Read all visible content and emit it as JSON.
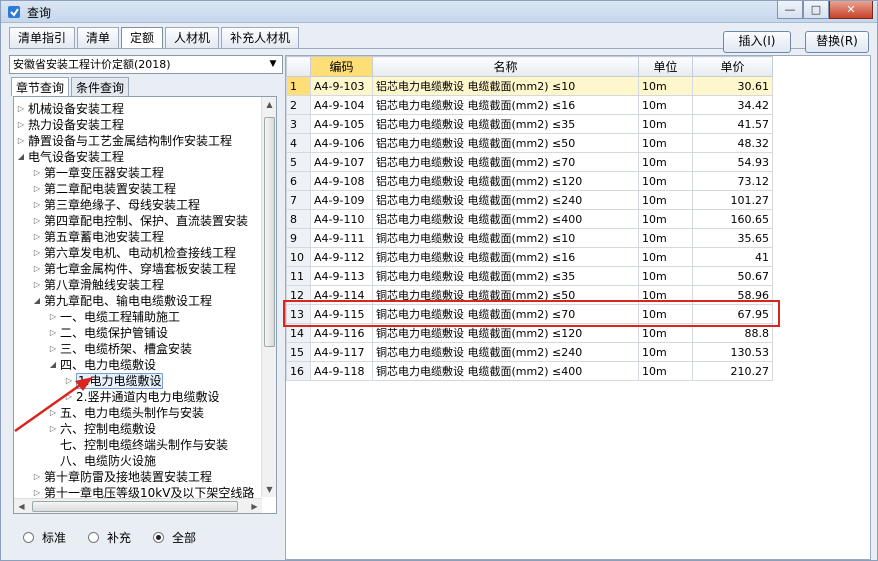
{
  "window": {
    "title": "查询"
  },
  "top_tabs": [
    {
      "label": "清单指引",
      "active": false
    },
    {
      "label": "清单",
      "active": false
    },
    {
      "label": "定额",
      "active": true
    },
    {
      "label": "人材机",
      "active": false
    },
    {
      "label": "补充人材机",
      "active": false
    }
  ],
  "buttons": {
    "insert": "插入(I)",
    "replace": "替换(R)"
  },
  "combo": {
    "value": "安徽省安装工程计价定额(2018)"
  },
  "left_tabs": [
    {
      "label": "章节查询",
      "active": true
    },
    {
      "label": "条件查询",
      "active": false
    }
  ],
  "tree": [
    {
      "label": "机械设备安装工程",
      "level": 0,
      "toggle": "▷"
    },
    {
      "label": "热力设备安装工程",
      "level": 0,
      "toggle": "▷"
    },
    {
      "label": "静置设备与工艺金属结构制作安装工程",
      "level": 0,
      "toggle": "▷"
    },
    {
      "label": "电气设备安装工程",
      "level": 0,
      "toggle": "◢"
    },
    {
      "label": "第一章变压器安装工程",
      "level": 1,
      "toggle": "▷"
    },
    {
      "label": "第二章配电装置安装工程",
      "level": 1,
      "toggle": "▷"
    },
    {
      "label": "第三章绝缘子、母线安装工程",
      "level": 1,
      "toggle": "▷"
    },
    {
      "label": "第四章配电控制、保护、直流装置安装",
      "level": 1,
      "toggle": "▷"
    },
    {
      "label": "第五章蓄电池安装工程",
      "level": 1,
      "toggle": "▷"
    },
    {
      "label": "第六章发电机、电动机检查接线工程",
      "level": 1,
      "toggle": "▷"
    },
    {
      "label": "第七章金属构件、穿墙套板安装工程",
      "level": 1,
      "toggle": "▷"
    },
    {
      "label": "第八章滑触线安装工程",
      "level": 1,
      "toggle": "▷"
    },
    {
      "label": "第九章配电、输电电缆敷设工程",
      "level": 1,
      "toggle": "◢"
    },
    {
      "label": "一、电缆工程辅助施工",
      "level": 2,
      "toggle": "▷"
    },
    {
      "label": "二、电缆保护管铺设",
      "level": 2,
      "toggle": "▷"
    },
    {
      "label": "三、电缆桥架、槽盒安装",
      "level": 2,
      "toggle": "▷"
    },
    {
      "label": "四、电力电缆敷设",
      "level": 2,
      "toggle": "◢"
    },
    {
      "label": "1.电力电缆敷设",
      "level": 3,
      "toggle": "▷",
      "selected": true
    },
    {
      "label": "2.竖井通道内电力电缆敷设",
      "level": 3,
      "toggle": "▷"
    },
    {
      "label": "五、电力电缆头制作与安装",
      "level": 2,
      "toggle": "▷"
    },
    {
      "label": "六、控制电缆敷设",
      "level": 2,
      "toggle": "▷"
    },
    {
      "label": "七、控制电缆终端头制作与安装",
      "level": 2,
      "toggle": ""
    },
    {
      "label": "八、电缆防火设施",
      "level": 2,
      "toggle": ""
    },
    {
      "label": "第十章防雷及接地装置安装工程",
      "level": 1,
      "toggle": "▷"
    },
    {
      "label": "第十一章电压等级10kV及以下架空线路",
      "level": 1,
      "toggle": "▷"
    }
  ],
  "radios": [
    {
      "label": "标准",
      "checked": false
    },
    {
      "label": "补充",
      "checked": false
    },
    {
      "label": "全部",
      "checked": true
    }
  ],
  "grid": {
    "headers": [
      "编码",
      "名称",
      "单位",
      "单价"
    ],
    "rows": [
      {
        "n": "1",
        "code": "A4-9-103",
        "name": "铝芯电力电缆敷设 电缆截面(mm2) ≤10",
        "unit": "10m",
        "price": "30.61"
      },
      {
        "n": "2",
        "code": "A4-9-104",
        "name": "铝芯电力电缆敷设 电缆截面(mm2) ≤16",
        "unit": "10m",
        "price": "34.42"
      },
      {
        "n": "3",
        "code": "A4-9-105",
        "name": "铝芯电力电缆敷设 电缆截面(mm2) ≤35",
        "unit": "10m",
        "price": "41.57"
      },
      {
        "n": "4",
        "code": "A4-9-106",
        "name": "铝芯电力电缆敷设 电缆截面(mm2) ≤50",
        "unit": "10m",
        "price": "48.32"
      },
      {
        "n": "5",
        "code": "A4-9-107",
        "name": "铝芯电力电缆敷设 电缆截面(mm2) ≤70",
        "unit": "10m",
        "price": "54.93"
      },
      {
        "n": "6",
        "code": "A4-9-108",
        "name": "铝芯电力电缆敷设 电缆截面(mm2) ≤120",
        "unit": "10m",
        "price": "73.12"
      },
      {
        "n": "7",
        "code": "A4-9-109",
        "name": "铝芯电力电缆敷设 电缆截面(mm2) ≤240",
        "unit": "10m",
        "price": "101.27"
      },
      {
        "n": "8",
        "code": "A4-9-110",
        "name": "铝芯电力电缆敷设 电缆截面(mm2) ≤400",
        "unit": "10m",
        "price": "160.65"
      },
      {
        "n": "9",
        "code": "A4-9-111",
        "name": "铜芯电力电缆敷设 电缆截面(mm2) ≤10",
        "unit": "10m",
        "price": "35.65"
      },
      {
        "n": "10",
        "code": "A4-9-112",
        "name": "铜芯电力电缆敷设 电缆截面(mm2) ≤16",
        "unit": "10m",
        "price": "41"
      },
      {
        "n": "11",
        "code": "A4-9-113",
        "name": "铜芯电力电缆敷设 电缆截面(mm2) ≤35",
        "unit": "10m",
        "price": "50.67"
      },
      {
        "n": "12",
        "code": "A4-9-114",
        "name": "铜芯电力电缆敷设 电缆截面(mm2) ≤50",
        "unit": "10m",
        "price": "58.96"
      },
      {
        "n": "13",
        "code": "A4-9-115",
        "name": "铜芯电力电缆敷设 电缆截面(mm2) ≤70",
        "unit": "10m",
        "price": "67.95"
      },
      {
        "n": "14",
        "code": "A4-9-116",
        "name": "铜芯电力电缆敷设 电缆截面(mm2) ≤120",
        "unit": "10m",
        "price": "88.8"
      },
      {
        "n": "15",
        "code": "A4-9-117",
        "name": "铜芯电力电缆敷设 电缆截面(mm2) ≤240",
        "unit": "10m",
        "price": "130.53"
      },
      {
        "n": "16",
        "code": "A4-9-118",
        "name": "铜芯电力电缆敷设 电缆截面(mm2) ≤400",
        "unit": "10m",
        "price": "210.27"
      }
    ]
  },
  "colors": {
    "annotation_red": "#d9251d",
    "selected_row": "#ffdd77"
  }
}
